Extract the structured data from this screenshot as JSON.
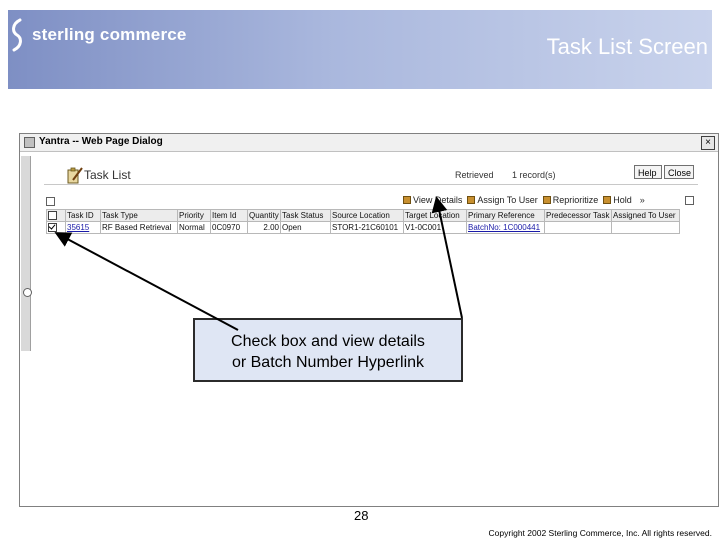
{
  "slide": {
    "logo_text": "sterling commerce",
    "title": "Task List Screen",
    "page_number": "28",
    "copyright": "Copyright 2002 Sterling Commerce, Inc. All rights reserved."
  },
  "dialog": {
    "window_title": "Yantra -- Web Page Dialog",
    "close_glyph": "×",
    "header_title": "Task List",
    "retrieved_label": "Retrieved",
    "record_count": "1 record(s)",
    "help_button": "Help",
    "close_button": "Close",
    "actions": [
      "View Details",
      "Assign To User",
      "Reprioritize",
      "Hold"
    ],
    "more_glyph": "»",
    "columns": [
      "Task ID",
      "Task Type",
      "Priority",
      "Item Id",
      "Quantity",
      "Task Status",
      "Source Location",
      "Target Location",
      "Primary Reference",
      "Predecessor Task",
      "Assigned To User"
    ],
    "rows": [
      {
        "checked": true,
        "cells": [
          "35615",
          "RF Based Retrieval",
          "Normal",
          "0C0970",
          "2.00",
          "Open",
          "STOR1-21C60101",
          "V1-0C001",
          "BatchNo: 1C000441",
          "",
          ""
        ]
      }
    ]
  },
  "callout": {
    "line1": "Check box and view details",
    "line2": "or Batch Number Hyperlink"
  },
  "icons": {
    "header": "clipboard-pencil-icon",
    "action": "action-folder-icon"
  },
  "colors": {
    "banner_start": "#7e8fc4",
    "banner_end": "#c9d3ec",
    "callout_fill": "#dfe6f4",
    "link": "#1a1aa8"
  }
}
